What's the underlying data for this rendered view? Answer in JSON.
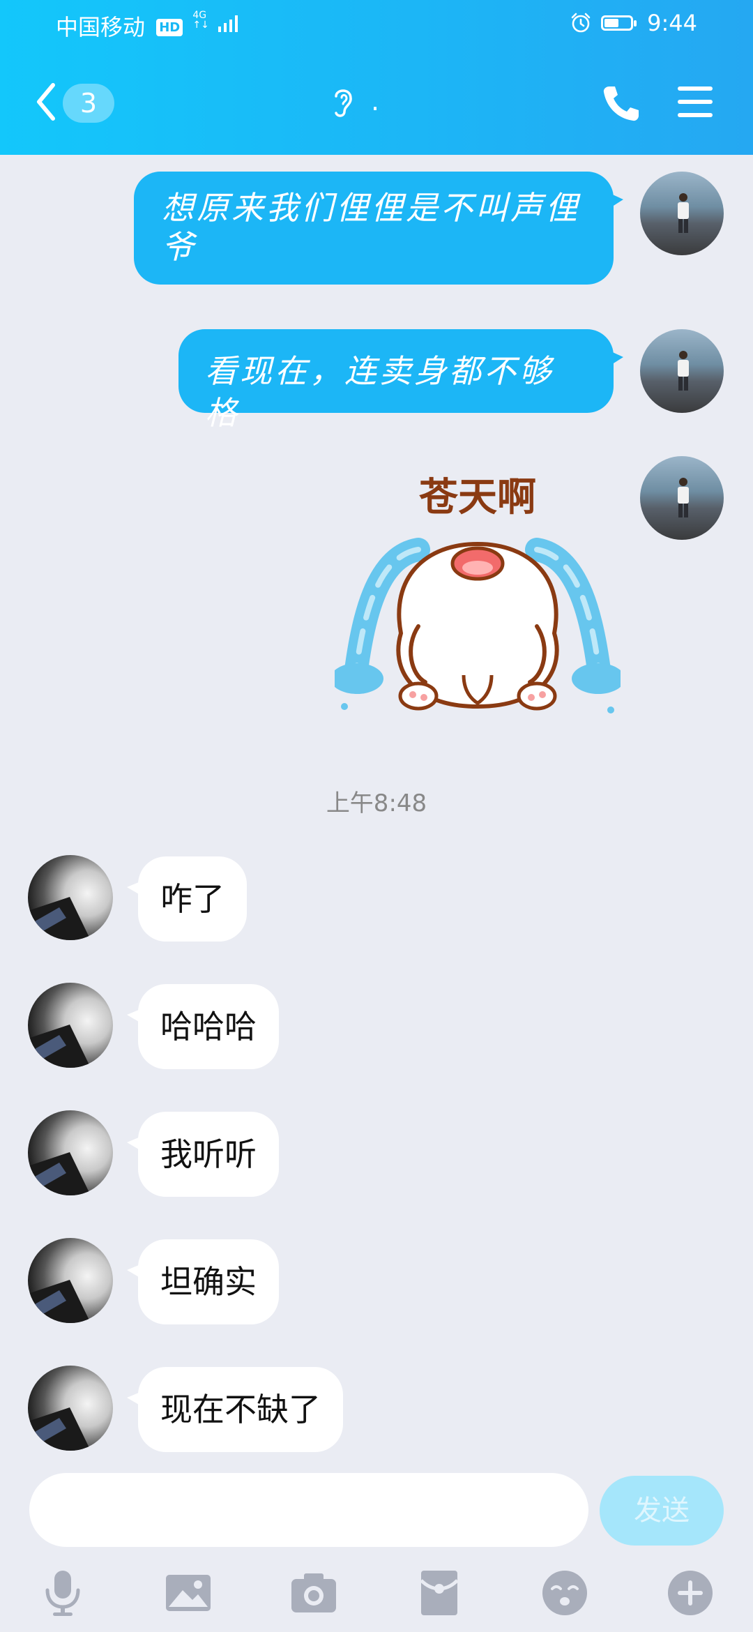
{
  "status_bar": {
    "carrier": "中国移动",
    "hd": "HD",
    "network": "4G",
    "network_sub": "↑↓",
    "time": "9:44",
    "battery_level": 0.55
  },
  "header": {
    "unread_count": "3",
    "title": "."
  },
  "messages_outgoing": [
    {
      "text": "想原来我们俚俚是不叫声俚爷"
    },
    {
      "text": "看现在，连卖身都不够格"
    }
  ],
  "sticker": {
    "caption": "苍天啊"
  },
  "timestamp": "上午8:48",
  "messages_incoming": [
    {
      "text": "咋了"
    },
    {
      "text": "哈哈哈"
    },
    {
      "text": "我听听"
    },
    {
      "text": "坦确实"
    },
    {
      "text": "现在不缺了"
    }
  ],
  "input": {
    "value": "",
    "placeholder": ""
  },
  "send_label": "发送",
  "toolbar": [
    "microphone-icon",
    "image-icon",
    "camera-icon",
    "red-packet-icon",
    "emoji-icon",
    "plus-icon"
  ],
  "colors": {
    "accent": "#1cb6f6",
    "background": "#eaecf3",
    "send_disabled": "#a5e6fb"
  }
}
